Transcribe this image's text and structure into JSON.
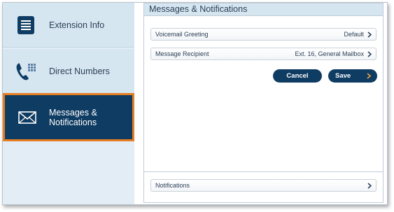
{
  "sidebar": {
    "items": [
      {
        "label": "Extension Info",
        "icon": "document-list-icon"
      },
      {
        "label": "Direct Numbers",
        "icon": "phone-keypad-icon"
      },
      {
        "label": "Messages & Notifications",
        "icon": "envelope-icon",
        "active": true
      }
    ]
  },
  "panel": {
    "title": "Messages & Notifications",
    "rows": [
      {
        "label": "Voicemail Greeting",
        "value": "Default"
      },
      {
        "label": "Message Recipient",
        "value": "Ext. 16, General Mailbox"
      }
    ],
    "cancel_label": "Cancel",
    "save_label": "Save",
    "notifications_label": "Notifications"
  },
  "colors": {
    "navy": "#0f3c63",
    "active_border": "#e67e22",
    "sidebar_bg": "#d6e6f1",
    "save_chevron": "#e8a33d"
  }
}
